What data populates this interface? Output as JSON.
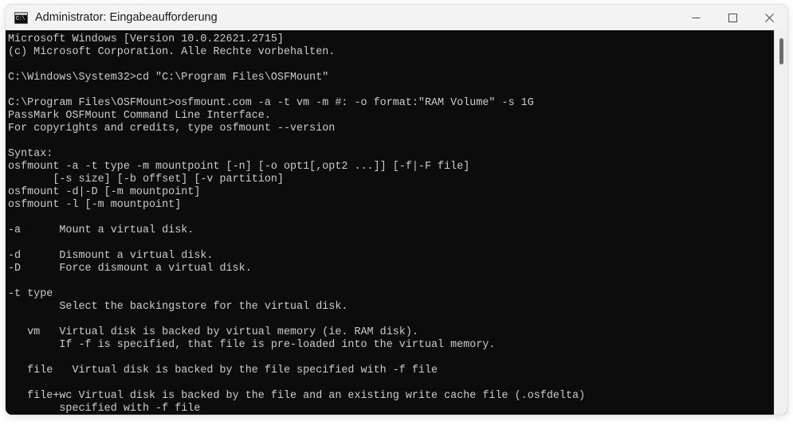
{
  "window": {
    "title": "Administrator: Eingabeaufforderung",
    "icon": "cmd-icon",
    "icon_glyph": "C:\\",
    "titlebar_bg": "#f3f3f3",
    "terminal_bg": "#0c0c0c",
    "terminal_fg": "#cccccc",
    "controls": {
      "minimize_label": "Minimieren",
      "maximize_label": "Maximieren",
      "close_label": "Schließen"
    }
  },
  "scrollbar": {
    "thumb_position_pct": 2,
    "thumb_size_pct": 7
  },
  "terminal": {
    "lines": [
      "Microsoft Windows [Version 10.0.22621.2715]",
      "(c) Microsoft Corporation. Alle Rechte vorbehalten.",
      "",
      "C:\\Windows\\System32>cd \"C:\\Program Files\\OSFMount\"",
      "",
      "C:\\Program Files\\OSFMount>osfmount.com -a -t vm -m #: -o format:\"RAM Volume\" -s 1G",
      "PassMark OSFMount Command Line Interface.",
      "For copyrights and credits, type osfmount --version",
      "",
      "Syntax:",
      "osfmount -a -t type -m mountpoint [-n] [-o opt1[,opt2 ...]] [-f|-F file]",
      "       [-s size] [-b offset] [-v partition]",
      "osfmount -d|-D [-m mountpoint]",
      "osfmount -l [-m mountpoint]",
      "",
      "-a      Mount a virtual disk.",
      "",
      "-d      Dismount a virtual disk.",
      "-D      Force dismount a virtual disk.",
      "",
      "-t type",
      "        Select the backingstore for the virtual disk.",
      "",
      "   vm   Virtual disk is backed by virtual memory (ie. RAM disk).",
      "        If -f is specified, that file is pre-loaded into the virtual memory.",
      "",
      "   file   Virtual disk is backed by the file specified with -f file",
      "",
      "   file+wc Virtual disk is backed by the file and an existing write cache file (.osfdelta)",
      "        specified with -f file"
    ]
  }
}
